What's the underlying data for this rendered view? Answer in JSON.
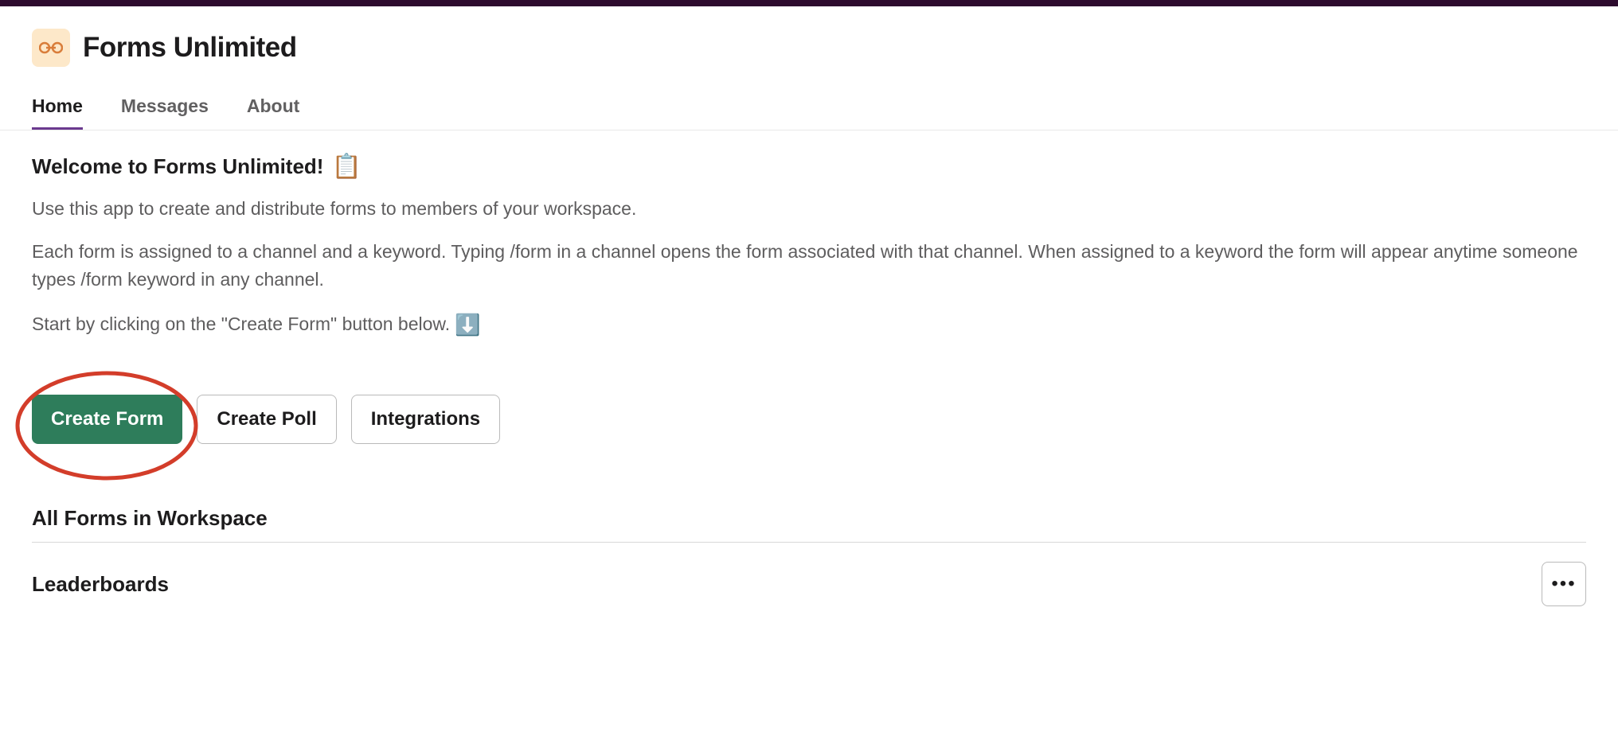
{
  "app": {
    "title": "Forms Unlimited"
  },
  "tabs": {
    "home": "Home",
    "messages": "Messages",
    "about": "About"
  },
  "welcome": {
    "heading": "Welcome to Forms Unlimited!",
    "line1": "Use this app to create and distribute forms to members of your workspace.",
    "line2": "Each form is assigned to a channel and a keyword. Typing /form in a channel opens the form associated with that channel. When assigned to a keyword the form will appear anytime someone types /form keyword in any channel.",
    "line3": "Start by clicking on the \"Create Form\" button below."
  },
  "buttons": {
    "create_form": "Create Form",
    "create_poll": "Create Poll",
    "integrations": "Integrations"
  },
  "sections": {
    "all_forms": "All Forms in Workspace",
    "leaderboards": "Leaderboards"
  }
}
